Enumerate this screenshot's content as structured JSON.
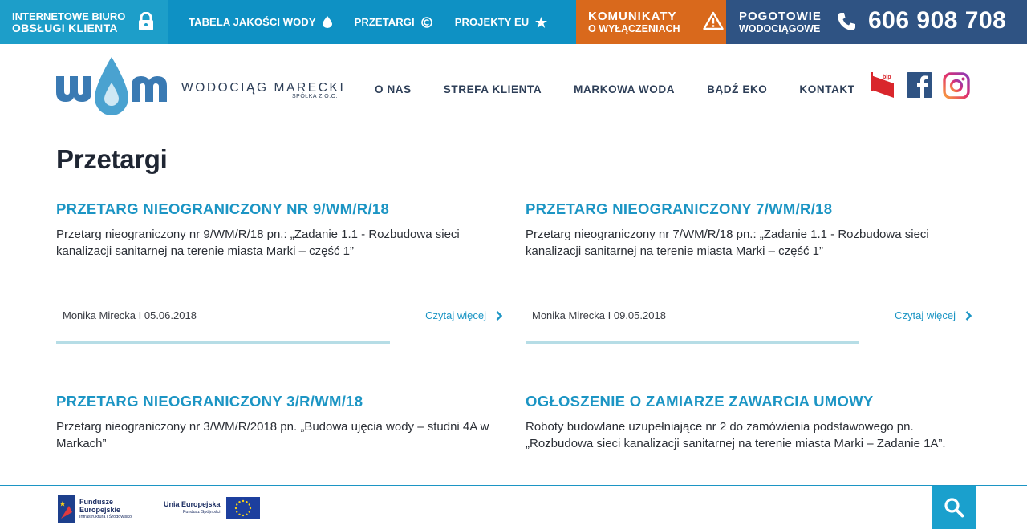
{
  "topbar": {
    "client_office_line1": "INTERNETOWE BIURO",
    "client_office_line2": "OBSŁUGI KLIENTA",
    "links": [
      {
        "label": "TABELA JAKOŚCI WODY",
        "icon": "water-drop-icon"
      },
      {
        "label": "PRZETARGI",
        "icon": "copyright-icon"
      },
      {
        "label": "PROJEKTY EU",
        "icon": "star-icon"
      }
    ],
    "outage_line1": "KOMUNIKATY",
    "outage_line2": "O WYŁĄCZENIACH",
    "emergency_line1": "POGOTOWIE",
    "emergency_line2": "WODOCIĄGOWE",
    "emergency_phone": "606 908 708"
  },
  "header": {
    "logo_name": "WODOCIĄG MARECKI",
    "logo_sub": "SPÓŁKA Z O.O.",
    "nav": [
      "O NAS",
      "STREFA KLIENTA",
      "MARKOWA WODA",
      "BĄDŹ EKO",
      "KONTAKT"
    ],
    "bip_label": "bip"
  },
  "page": {
    "title": "Przetargi",
    "read_more_label": "Czytaj więcej",
    "posts": [
      {
        "title": "PRZETARG NIEOGRANICZONY NR 9/WM/R/18",
        "excerpt": "Przetarg nieograniczony nr 9/WM/R/18 pn.: „Zadanie 1.1 - Rozbudowa sieci kanalizacji sanitarnej na terenie miasta Marki – część 1”",
        "meta": "Monika Mirecka I 05.06.2018"
      },
      {
        "title": "PRZETARG NIEOGRANICZONY 7/WM/R/18",
        "excerpt": "Przetarg nieograniczony nr 7/WM/R/18 pn.: „Zadanie 1.1 - Rozbudowa sieci kanalizacji sanitarnej na terenie miasta Marki – część 1”",
        "meta": "Monika Mirecka I 09.05.2018"
      },
      {
        "title": "PRZETARG NIEOGRANICZONY 3/R/WM/18",
        "excerpt": "Przetarg nieograniczony nr 3/WM/R/2018 pn. „Budowa ujęcia wody – studni 4A w Markach”"
      },
      {
        "title": "OGŁOSZENIE O ZAMIARZE ZAWARCIA UMOWY",
        "excerpt": "Roboty budowlane uzupełniające nr 2 do zamówienia podstawowego pn. „Rozbudowa sieci kanalizacji sanitarnej na terenie miasta Marki – Zadanie 1A”."
      }
    ]
  },
  "footer": {
    "fe_line1": "Fundusze",
    "fe_line2": "Europejskie",
    "fe_line3": "Infrastruktura i Środowisko",
    "ue_line1": "Unia Europejska",
    "ue_line2": "Fundusz Spójności"
  },
  "colors": {
    "topbar_client": "#1d9ec9",
    "topbar_links": "#0e91c4",
    "topbar_outage": "#d9691c",
    "topbar_emergency": "#2f5383",
    "accent": "#1c95c4",
    "divider": "#b6dde6"
  }
}
